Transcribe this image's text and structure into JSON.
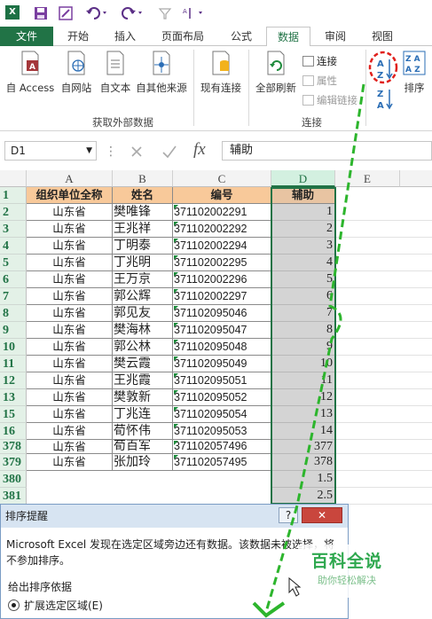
{
  "tabs": [
    "文件",
    "开始",
    "插入",
    "页面布局",
    "公式",
    "数据",
    "审阅",
    "视图"
  ],
  "ribbon": {
    "external_buttons": [
      "自 Access",
      "自网站",
      "自文本",
      "自其他来源"
    ],
    "existing_conn": "现有连接",
    "refresh_all": "全部刷新",
    "conn_items": [
      "连接",
      "属性",
      "编辑链接"
    ],
    "sort_label": "排序",
    "groups": [
      "获取外部数据",
      "连接"
    ]
  },
  "formula_bar": {
    "name_box": "D1",
    "fx": "fx",
    "content": "辅助"
  },
  "columns": [
    "A",
    "B",
    "C",
    "D",
    "E"
  ],
  "headers": [
    "组织单位全称",
    "姓名",
    "编号",
    "辅助"
  ],
  "rows": [
    {
      "row": "2",
      "a": "山东省",
      "b": "樊唯锋",
      "c": "371102002291",
      "d": "1"
    },
    {
      "row": "3",
      "a": "山东省",
      "b": "王兆祥",
      "c": "371102002292",
      "d": "2"
    },
    {
      "row": "4",
      "a": "山东省",
      "b": "丁明泰",
      "c": "371102002294",
      "d": "3"
    },
    {
      "row": "5",
      "a": "山东省",
      "b": "丁兆明",
      "c": "371102002295",
      "d": "4"
    },
    {
      "row": "6",
      "a": "山东省",
      "b": "王万京",
      "c": "371102002296",
      "d": "5"
    },
    {
      "row": "7",
      "a": "山东省",
      "b": "郭公辉",
      "c": "371102002297",
      "d": "6"
    },
    {
      "row": "8",
      "a": "山东省",
      "b": "郭见友",
      "c": "371102095046",
      "d": "7"
    },
    {
      "row": "9",
      "a": "山东省",
      "b": "樊海林",
      "c": "371102095047",
      "d": "8"
    },
    {
      "row": "10",
      "a": "山东省",
      "b": "郭公林",
      "c": "371102095048",
      "d": "9"
    },
    {
      "row": "11",
      "a": "山东省",
      "b": "樊云霞",
      "c": "371102095049",
      "d": "10"
    },
    {
      "row": "12",
      "a": "山东省",
      "b": "王兆霞",
      "c": "371102095051",
      "d": "11"
    },
    {
      "row": "13",
      "a": "山东省",
      "b": "樊敦新",
      "c": "371102095052",
      "d": "12"
    },
    {
      "row": "15",
      "a": "山东省",
      "b": "丁兆连",
      "c": "371102095054",
      "d": "13"
    },
    {
      "row": "16",
      "a": "山东省",
      "b": "荀怀伟",
      "c": "371102095053",
      "d": "14"
    },
    {
      "row": "378",
      "a": "山东省",
      "b": "荀百军",
      "c": "371102057496",
      "d": "377"
    },
    {
      "row": "379",
      "a": "山东省",
      "b": "张加玲",
      "c": "371102057495",
      "d": "378"
    },
    {
      "row": "380",
      "a": "",
      "b": "",
      "c": "",
      "d": "1.5"
    },
    {
      "row": "381",
      "a": "",
      "b": "",
      "c": "",
      "d": "2.5"
    }
  ],
  "dialog": {
    "title": "排序提醒",
    "help": "?",
    "close": "✕",
    "message": "Microsoft Excel 发现在选定区域旁边还有数据。该数据未被选择，将不参加排序。",
    "basis_label": "给出排序依据",
    "option": "扩展选定区域(E)"
  },
  "watermark": {
    "title": "百科全说",
    "subtitle": "助你轻松解决"
  },
  "icons": [
    "excel-logo-icon",
    "save-icon",
    "edit-icon",
    "undo-icon",
    "redo-icon",
    "sort-az-icon",
    "sort-za-icon",
    "sort-icon"
  ]
}
